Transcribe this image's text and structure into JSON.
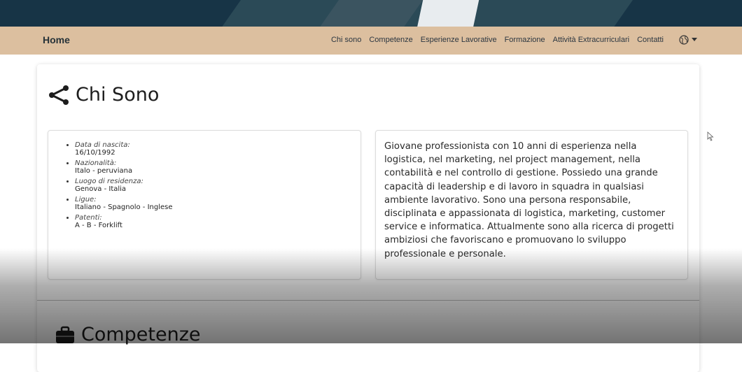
{
  "navbar": {
    "brand": "Home",
    "links": [
      "Chi sono",
      "Competenze",
      "Esperienze Lavorative",
      "Formazione",
      "Attività Extracurriculari",
      "Contatti"
    ],
    "language_icon": "globe-icon"
  },
  "about": {
    "title": "Chi Sono",
    "title_icon": "share-icon",
    "details": [
      {
        "label": "Data di nascita:",
        "value": "16/10/1992"
      },
      {
        "label": "Nazionalità:",
        "value": "Italo - peruviana"
      },
      {
        "label": "Luogo di residenza:",
        "value": "Genova - Italia"
      },
      {
        "label": "Ligue:",
        "value": "Italiano - Spagnolo - Inglese"
      },
      {
        "label": "Patenti:",
        "value": "A - B - Forklift"
      }
    ],
    "bio": "Giovane professionista con 10 anni di esperienza nella logistica, nel marketing, nel project management, nella contabilità e nel controllo di gestione. Possiedo una grande capacità di leadership e di lavoro in squadra in qualsiasi ambiente lavorativo. Sono una persona responsabile, disciplinata e appassionata di logistica, marketing, customer service e informatica. Attualmente sono alla ricerca di progetti ambiziosi che favoriscano e promuovano lo sviluppo professionale e personale."
  },
  "skills": {
    "title": "Competenze",
    "title_icon": "briefcase-icon"
  },
  "colors": {
    "navbar_bg": "#dcbf9f",
    "hero_bg": "#173446"
  }
}
